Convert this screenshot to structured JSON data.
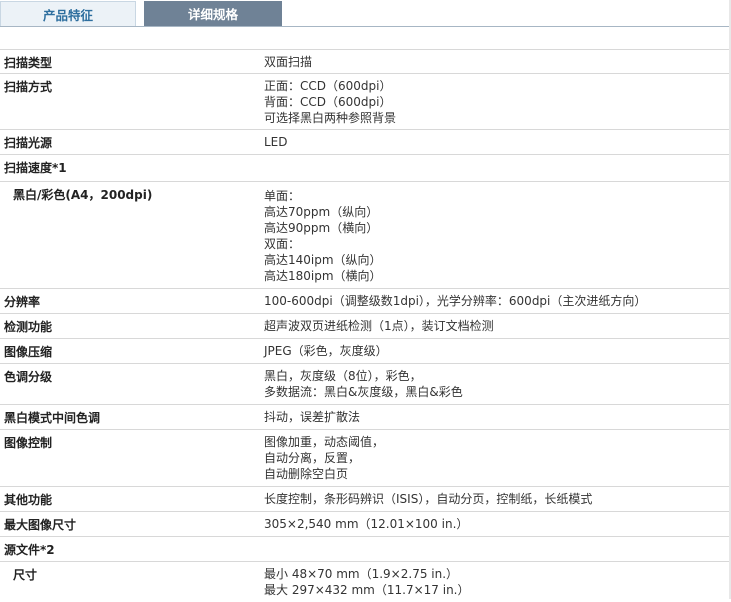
{
  "tabs": [
    {
      "label": "产品特征"
    },
    {
      "label": "详细规格"
    }
  ],
  "specs": [
    {
      "label": "扫描类型",
      "values": [
        "双面扫描"
      ]
    },
    {
      "label": "扫描方式",
      "values": [
        "正面：CCD（600dpi）",
        "背面：CCD（600dpi）",
        "可选择黑白两种参照背景"
      ]
    },
    {
      "label": "扫描光源",
      "values": [
        "LED"
      ]
    },
    {
      "label": "扫描速度*1",
      "values": []
    },
    {
      "label": "黑白/彩色(A4，200dpi)",
      "values": [
        "单面：",
        "高达70ppm（纵向）",
        "高达90ppm（横向）",
        "双面：",
        "高达140ipm（纵向）",
        "高达180ipm（横向）"
      ]
    },
    {
      "label": "分辨率",
      "values": [
        "100-600dpi（调整级数1dpi），光学分辨率：600dpi（主次进纸方向）"
      ]
    },
    {
      "label": "检测功能",
      "values": [
        "超声波双页进纸检测（1点），装订文档检测"
      ]
    },
    {
      "label": "图像压缩",
      "values": [
        "JPEG（彩色，灰度级）"
      ]
    },
    {
      "label": "色调分级",
      "values": [
        "黑白，灰度级（8位），彩色，",
        "多数据流：黑白&灰度级，黑白&彩色"
      ]
    },
    {
      "label": "黑白模式中间色调",
      "values": [
        "抖动，误差扩散法"
      ]
    },
    {
      "label": "图像控制",
      "values": [
        "图像加重，动态阈值，",
        "自动分离，反置，",
        "自动删除空白页"
      ]
    },
    {
      "label": "其他功能",
      "values": [
        "长度控制，条形码辨识（ISIS），自动分页，控制纸，长纸模式"
      ]
    },
    {
      "label": "最大图像尺寸",
      "values": [
        "305×2,540 mm（12.01×100 in.）"
      ]
    },
    {
      "label": "源文件*2",
      "values": []
    },
    {
      "label": "尺寸",
      "values": [
        "最小 48×70 mm（1.9×2.75 in.）",
        "最大 297×432 mm（11.7×17 in.）"
      ]
    }
  ]
}
